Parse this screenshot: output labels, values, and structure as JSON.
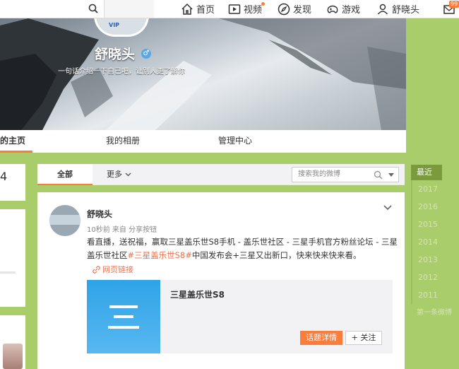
{
  "nav": {
    "items": [
      {
        "label": "首页",
        "icon": "home-icon"
      },
      {
        "label": "视频",
        "icon": "video-icon"
      },
      {
        "label": "发现",
        "icon": "compass-icon"
      },
      {
        "label": "游戏",
        "icon": "game-icon"
      },
      {
        "label": "舒晓头",
        "icon": "user-icon"
      }
    ],
    "message_badge": "99",
    "accent": "#fa7d3c"
  },
  "profile": {
    "name": "舒晓头",
    "gender_symbol": "♂",
    "intro": "一句话介绍一下自己吧，让别人更了解你",
    "avatar_text": "VIP"
  },
  "tabs": [
    "的主页",
    "我的相册",
    "管理中心"
  ],
  "left": {
    "count": "4"
  },
  "filter": {
    "all": "全部",
    "more": "更多",
    "search_placeholder": "搜索我的微博"
  },
  "post": {
    "author": "舒晓头",
    "meta": "10秒前 来自 分享按钮",
    "text_before": "看直播，送祝福，赢取三星盖乐世S8手机 - 盖乐世社区 - 三星手机官方粉丝论坛 - 三星盖乐世社区",
    "hashtag": "#三星盖乐世S8#",
    "text_after": "中国发布会+三星又出新口，快来快来快来看。",
    "weblink": "网页链接",
    "card_title": "三星盖乐世S8",
    "detail_button": "话题详情",
    "follow_button": "+ 关注"
  },
  "timeline": [
    "最近",
    "2017",
    "2016",
    "2015",
    "2014",
    "2013",
    "2012",
    "2011",
    "第一条微博"
  ]
}
